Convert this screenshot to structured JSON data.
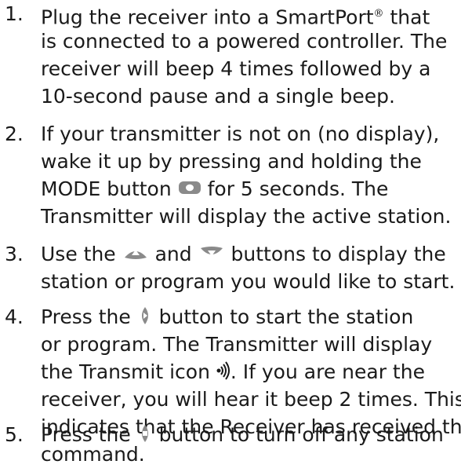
{
  "steps": [
    {
      "number": "1.",
      "lines": [
        {
          "text": "Plug the receiver into a SmartPort"
        },
        {
          "text": "is connected to a powered controller. The"
        },
        {
          "text": "receiver will beep 4 times followed by a"
        },
        {
          "text": "10-second pause and a single beep."
        }
      ],
      "registered_mark": "®",
      "line1_tail": " that"
    },
    {
      "number": "2.",
      "lines": [
        {
          "text": "If your transmitter is not on (no display),"
        },
        {
          "text": "wake it up by pressing and holding the"
        },
        {
          "before": "MODE button ",
          "after": " for 5 seconds. The",
          "icon": "mode-button-icon"
        },
        {
          "text": "Transmitter will display the active station."
        }
      ]
    },
    {
      "number": "3.",
      "lines": [
        {
          "before": "Use the ",
          "middle": " and ",
          "after": " buttons to display the",
          "icon1": "up-arrow-button-icon",
          "icon2": "down-arrow-button-icon"
        },
        {
          "text": "station or program you would like to start."
        }
      ]
    },
    {
      "number": "4.",
      "lines": [
        {
          "before": "Press the ",
          "after": " button to start the station",
          "icon": "start-button-icon"
        },
        {
          "text": "or program. The Transmitter will display"
        },
        {
          "before": "the Transmit icon ",
          "after": ". If you are near the",
          "icon": "transmit-icon"
        },
        {
          "text": "receiver, you will hear it beep 2 times. This"
        },
        {
          "text": "indicates that the Receiver has received the"
        },
        {
          "text": "command."
        }
      ]
    },
    {
      "number": "5.",
      "lines": [
        {
          "before": "Press the ",
          "after": " button to turn off any station",
          "icon": "stop-button-icon"
        }
      ]
    }
  ]
}
